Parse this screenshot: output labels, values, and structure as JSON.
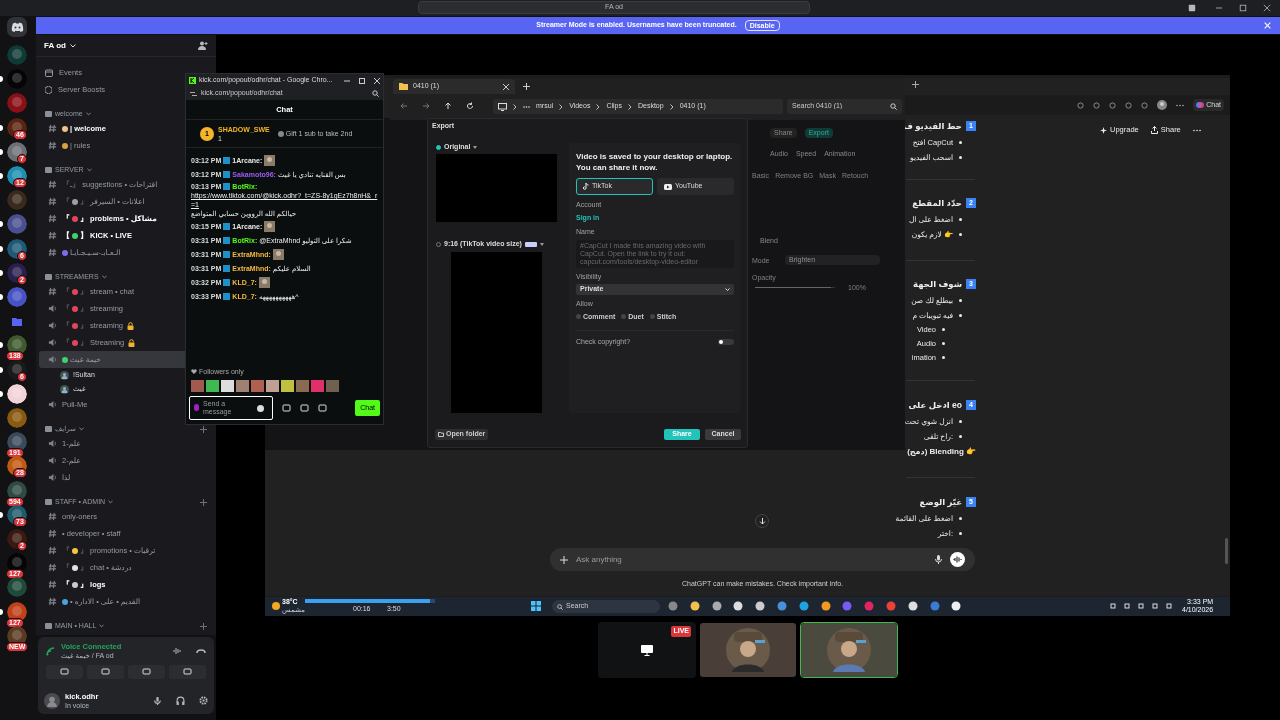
{
  "title_bar": {
    "title": "FA od"
  },
  "banner": {
    "message": "Streamer Mode is enabled. Usernames have been truncated.",
    "button": "Disable"
  },
  "server_rail": [
    {
      "unread": false
    },
    {
      "unread": true
    },
    {
      "unread": false
    },
    {
      "unread": true,
      "badge": "46"
    },
    {
      "unread": true,
      "badge": "7"
    },
    {
      "unread": true,
      "badge": "12"
    },
    {
      "unread": false
    },
    {
      "unread": true
    },
    {
      "unread": true,
      "badge": "6"
    },
    {
      "unread": true,
      "badge": "2"
    },
    {
      "unread": true
    },
    {
      "unread": false,
      "kind": "folder"
    },
    {
      "unread": true,
      "badge": "138"
    },
    {
      "unread": true,
      "badge": "6"
    },
    {
      "unread": true
    },
    {
      "unread": false
    },
    {
      "unread": false,
      "badge": "191"
    },
    {
      "unread": false,
      "badge": "28"
    },
    {
      "unread": false,
      "badge": "594"
    },
    {
      "unread": true,
      "badge": "73"
    },
    {
      "unread": false,
      "badge": "2"
    },
    {
      "unread": false,
      "badge": "127"
    },
    {
      "unread": false
    },
    {
      "unread": true,
      "badge": "127"
    },
    {
      "unread": false,
      "badge": "NEW"
    }
  ],
  "sidebar": {
    "server_name": "FA od",
    "links": [
      "Events",
      "Server Boosts"
    ],
    "categories": [
      {
        "name": "welcome",
        "channels": [
          {
            "kind": "text",
            "name": "| welcome",
            "unread": true,
            "color": "#f0c090"
          },
          {
            "kind": "text",
            "name": "| rules",
            "unread": false,
            "color": "#d9a046"
          }
        ]
      },
      {
        "name": "SERVER",
        "channels": [
          {
            "kind": "text",
            "name": "『ـ』 suggestions • اقتراحات",
            "unread": false
          },
          {
            "kind": "text",
            "open": "『",
            "color": "#9aa0a6",
            "name": "』 اعلانات • السيرفر",
            "unread": false
          },
          {
            "kind": "text",
            "open": "『",
            "color": "#e2455f",
            "name": "』 problems • مشاكل",
            "unread": true
          },
          {
            "kind": "text",
            "open": "【",
            "color": "#3fd16f",
            "name": "】 KICK • LIVE",
            "unread": true
          },
          {
            "kind": "text",
            "name": "الـعـابـ-سـيـجـايـا",
            "color": "#7b6cf0",
            "unread": false
          }
        ]
      },
      {
        "name": "STREAMERS",
        "channels": [
          {
            "kind": "text",
            "open": "『",
            "color": "#e2455f",
            "name": "』 stream • chat",
            "unread": false
          },
          {
            "kind": "voice",
            "open": "『",
            "color": "#e2455f",
            "name": "』 streaming",
            "unread": false,
            "locked": false
          },
          {
            "kind": "voice",
            "open": "『",
            "color": "#e2455f",
            "name": "』 streaming",
            "unread": false,
            "locked": true
          },
          {
            "kind": "voice",
            "open": "『",
            "color": "#e2455f",
            "name": "』 Streaming",
            "unread": false,
            "locked": true
          },
          {
            "kind": "voice",
            "name": "خيمة غيث",
            "color": "#3fd16f",
            "unread": false,
            "selected": true,
            "members": [
              "!Sultan",
              "غيث"
            ]
          },
          {
            "kind": "voice",
            "name": "Pull-Me",
            "unread": false
          }
        ]
      },
      {
        "name": "سرايف",
        "channels": [
          {
            "kind": "voice",
            "name": "علم-1",
            "unread": false
          },
          {
            "kind": "voice",
            "name": "علم-2",
            "unread": false
          },
          {
            "kind": "voice",
            "name": "لذا",
            "unread": false
          }
        ]
      },
      {
        "name": "STAFF • ADMIN",
        "channels": [
          {
            "kind": "text",
            "name": "only-oners",
            "unread": false
          },
          {
            "kind": "text",
            "name": "• developer • staff",
            "unread": false
          },
          {
            "kind": "text",
            "open": "『",
            "color": "#f5c542",
            "name": "』 promotions • ترقيات",
            "unread": false
          },
          {
            "kind": "text",
            "open": "『",
            "color": "#dfe3e8",
            "name": "』 chat • دردشة",
            "unread": false
          },
          {
            "kind": "text",
            "open": "『",
            "color": "#c8ccd2",
            "name": "』 logs",
            "unread": true
          },
          {
            "kind": "text",
            "name": "• القديم • على • الاداره",
            "color": "#4aa3df",
            "unread": false
          }
        ]
      },
      {
        "name": "MAIN • HALL"
      }
    ]
  },
  "voice_panel": {
    "status": "Voice Connected",
    "channel": "خيمة غيث / FA od"
  },
  "user_panel": {
    "name": "kick.odhr",
    "status": "In voice"
  },
  "kick_chat": {
    "window_title": "kick.com/popout/odhr/chat - Google Chro...",
    "url": "kick.com/popout/odhr/chat",
    "header": "Chat",
    "leader": {
      "rank": "1",
      "name": "SHADOW_SWE",
      "count": "1",
      "gift": "Gift 1 sub to take 2nd"
    },
    "messages": [
      {
        "time": "03:12 PM",
        "user": "1Arcane:",
        "color": "#e8e8e8",
        "emote": true
      },
      {
        "time": "03:12 PM",
        "user": "Sakamoto96:",
        "color": "#9b5cf0",
        "text": "بس القنايه تنادي يا غيث"
      },
      {
        "time": "03:13 PM",
        "user": "BotRix:",
        "color": "#53fc18",
        "link": "https://www.tiktok.com/@kick.odhr?_t=ZS-8y1gEz7h8nH&_r=1",
        "text": "حيالكم الله الرووين حسابي المتواضع"
      },
      {
        "time": "03:15 PM",
        "user": "1Arcane:",
        "color": "#e8e8e8",
        "emote": true
      },
      {
        "time": "03:31 PM",
        "user": "BotRix:",
        "color": "#53fc18",
        "text": "@ExtraMhnd شكرا على التوليو"
      },
      {
        "time": "03:31 PM",
        "user": "ExtraMhnd:",
        "color": "#f5b942",
        "emote": true
      },
      {
        "time": "03:31 PM",
        "user": "ExtraMhnd:",
        "color": "#f5b942",
        "text": "السلام عليكم"
      },
      {
        "time": "03:32 PM",
        "user": "KLD_7:",
        "color": "#f5b942",
        "emote": true
      },
      {
        "time": "03:33 PM",
        "user": "KLD_7:",
        "color": "#f5b942",
        "text": "ههههههههههه^"
      }
    ],
    "mode": "Followers only",
    "placeholder": "Send a message",
    "button": "Chat"
  },
  "explorer": {
    "tab": "0410 (1)",
    "path": [
      "mrsul",
      "Videos",
      "Clips",
      "Desktop",
      "0410 (1)"
    ],
    "search_placeholder": "Search 0410 (1)"
  },
  "export_dialog": {
    "title": "Export",
    "formats": [
      {
        "label": "Original",
        "selected": true
      },
      {
        "label": "9:16 (TikTok video size)",
        "selected": false
      }
    ],
    "heading": "Video is saved to your desktop or laptop. You can share it now.",
    "platforms": [
      {
        "label": "TikTok",
        "selected": true
      },
      {
        "label": "YouTube",
        "selected": false
      }
    ],
    "account_label": "Account",
    "sign_in": "Sign in",
    "name_label": "Name",
    "name_placeholder": "#CapCut I made this amazing video with CapCut. Open the link to try it out: capcut.com/tools/desktop-video-editor",
    "visibility_label": "Visibility",
    "visibility": "Private",
    "allow_label": "Allow",
    "allow": [
      {
        "label": "Comment",
        "checked": false
      },
      {
        "label": "Duet",
        "checked": false
      },
      {
        "label": "Stitch",
        "checked": false
      }
    ],
    "copyright": {
      "label": "Check copyright?",
      "on": false
    },
    "open_folder": "Open folder",
    "share": "Share",
    "cancel": "Cancel"
  },
  "capcut": {
    "buttons": [
      "Share",
      "Export"
    ],
    "tabs": [
      "Audio",
      "Speed",
      "Animation"
    ],
    "subtabs": [
      "Basic",
      "Remove BG",
      "Mask",
      "Retouch"
    ],
    "blend": "Blend",
    "mode_label": "Mode",
    "mode": "Brighten",
    "opacity_label": "Opacity",
    "opacity": "100%",
    "opacity_slider": {
      "level": 0.95
    }
  },
  "chatgpt": {
    "browser_button": "Chat",
    "upgrade": "Upgrade",
    "share": "Share",
    "sections": [
      {
        "number": "1",
        "title": "حط الفيديو ف",
        "bullets": [
          "افتح CapCut",
          "اسحب الفيديو"
        ]
      },
      {
        "number": "2",
        "title": "حدّد المقطع",
        "bullets": [
          "اضغط على ال",
          "لازم يكون 👉"
        ]
      },
      {
        "number": "3",
        "title": "شوف الجهة",
        "bullets": [
          "بيطلع لك صن",
          "فيه تبويبات م"
        ],
        "sub_bullets": [
          "Video",
          "Audio",
          "imation"
        ]
      },
      {
        "number": "4",
        "title": "ادخل على eo",
        "bullets": [
          "انزل شوي تحت",
          "راح تلقى:"
        ],
        "note": "(دمج) Blending 👉"
      },
      {
        "number": "5",
        "title": "غيّر الوضع",
        "bullets": [
          "اضغط على القائمة",
          "اختر:"
        ]
      }
    ],
    "placeholder": "Ask anything",
    "disclaimer": "ChatGPT can make mistakes. Check important info."
  },
  "taskbar": {
    "weather": "38°C",
    "weather_note": "مشمس",
    "progress": {
      "level": 0.96
    },
    "elapsed": "00:16",
    "remaining": "3:50",
    "search": {
      "placeholder": "Search"
    },
    "time": "3:33 PM",
    "date": "4/10/2026"
  },
  "stream_tiles": [
    {
      "kind": "screen",
      "live": "LIVE",
      "selected": false
    },
    {
      "kind": "user",
      "selected": false
    },
    {
      "kind": "user",
      "selected": true
    }
  ]
}
